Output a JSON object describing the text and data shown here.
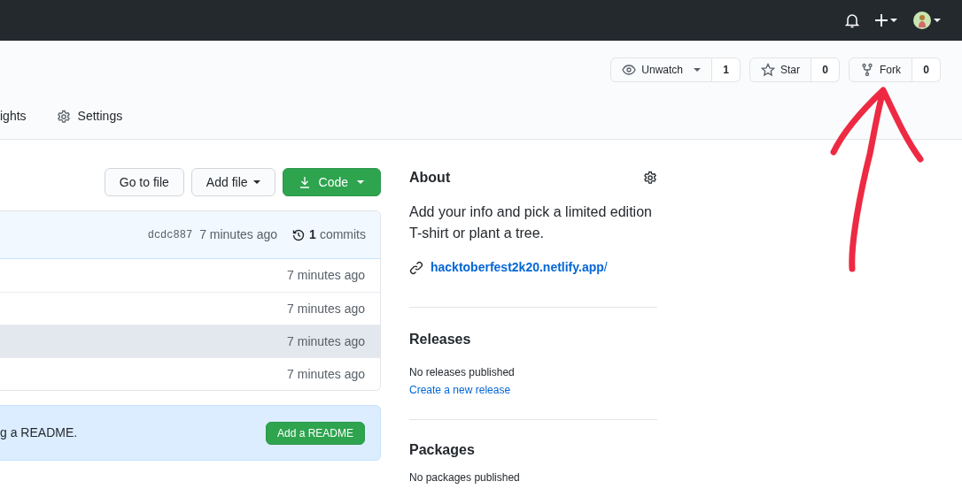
{
  "header": {
    "actions": [
      {
        "kind": "watch",
        "label": "Unwatch",
        "count": "1"
      },
      {
        "kind": "star",
        "label": "Star",
        "count": "0"
      },
      {
        "kind": "fork",
        "label": "Fork",
        "count": "0"
      }
    ]
  },
  "tabs": [
    {
      "label": "ights",
      "icon": false
    },
    {
      "label": "Settings",
      "icon": true
    }
  ],
  "toolbar": {
    "goto": "Go to file",
    "add": "Add file",
    "code": "Code"
  },
  "commit": {
    "hash": "dcdc887",
    "time": "7 minutes ago",
    "count": "1",
    "count_label": "commits"
  },
  "files": [
    {
      "time": "7 minutes ago",
      "selected": false
    },
    {
      "time": "7 minutes ago",
      "selected": false
    },
    {
      "time": "7 minutes ago",
      "selected": true
    },
    {
      "time": "7 minutes ago",
      "selected": false
    }
  ],
  "readme": {
    "text": "g a README.",
    "button": "Add a README"
  },
  "about": {
    "title": "About",
    "description": "Add your info and pick a limited edition T-shirt or plant a tree.",
    "link": "hacktoberfest2k20.netlify.app",
    "link_suffix": "/"
  },
  "releases": {
    "title": "Releases",
    "empty": "No releases published",
    "create": "Create a new release"
  },
  "packages": {
    "title": "Packages",
    "empty": "No packages published"
  }
}
